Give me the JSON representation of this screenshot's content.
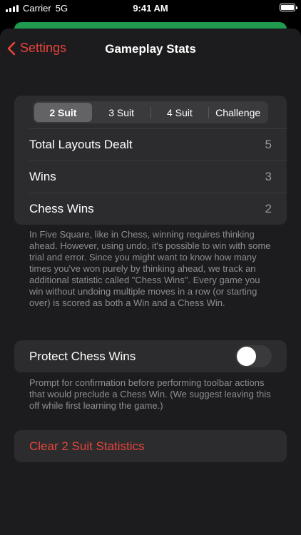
{
  "status_bar": {
    "carrier": "Carrier",
    "network": "5G",
    "time": "9:41 AM"
  },
  "nav": {
    "back_label": "Settings",
    "title": "Gameplay Stats"
  },
  "segmented": {
    "options": [
      "2 Suit",
      "3 Suit",
      "4 Suit",
      "Challenge"
    ],
    "selected": "2 Suit"
  },
  "stats": [
    {
      "label": "Total Layouts Dealt",
      "value": "5"
    },
    {
      "label": "Wins",
      "value": "3"
    },
    {
      "label": "Chess Wins",
      "value": "2"
    }
  ],
  "stats_footer": "In Five Square, like in Chess, winning requires thinking ahead. However, using undo, it's possible to win with some trial and error. Since you might want to know how many times you've won purely by thinking ahead, we track an additional statistic called \"Chess Wins\". Every game you win without undoing multiple moves in a row (or starting over) is scored as both a Win and a Chess Win.",
  "protect": {
    "label": "Protect Chess Wins",
    "enabled": false,
    "footer": "Prompt for confirmation before performing toolbar actions that would preclude a Chess Win. (We suggest leaving this off while first learning the game.)"
  },
  "clear_button": {
    "label": "Clear 2 Suit Statistics"
  },
  "colors": {
    "accent": "#e8443a",
    "group_bg": "#2c2c2e",
    "sheet_bg": "#1c1c1e",
    "under_sheet": "#1f9a4e"
  }
}
